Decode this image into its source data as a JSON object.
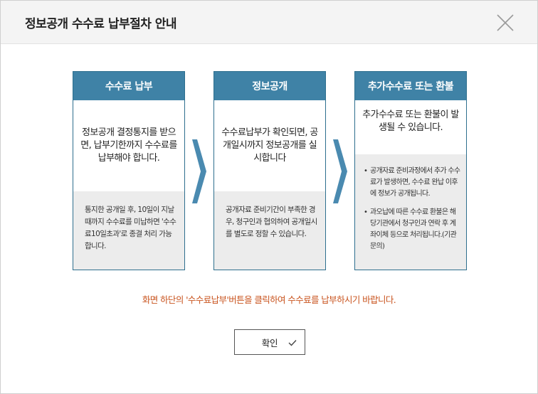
{
  "header": {
    "title": "정보공개 수수료 납부절차 안내",
    "close_icon": "close-icon"
  },
  "steps": [
    {
      "title": "수수료 납부",
      "main": "정보공개 결정통지를 받으면, 납부기한까지 수수료를 납부해야 합니다.",
      "sub": "통지한 공개일 후, 10일이 지날 때까지 수수료를 미납하면 '수수료10일초과'로 종결 처리 가능합니다."
    },
    {
      "title": "정보공개",
      "main": "수수료납부가 확인되면, 공개일시까지 정보공개를 실시합니다",
      "sub": "공개자료 준비기간이 부족한 경우, 청구인과 협의하여 공개일시를 별도로 정할 수 있습니다."
    },
    {
      "title": "추가수수료 또는 환불",
      "main": "추가수수료 또는 환불이 발생될 수 있습니다.",
      "bullets": [
        "공개자료 준비과정에서 추가 수수료가 발생하면, 수수료 완납 이후에 정보가 공개됩니다.",
        "과오납에 따른 수수료 환불은 해당기관에서 청구인과 연락 후 계좌이체 등으로 처리됩니다.(기관문의)"
      ]
    }
  ],
  "notice": "화면 하단의 '수수료납부'버튼을 클릭하여 수수료를 납부하시기 바랍니다.",
  "confirm": {
    "label": "확인",
    "icon": "check-icon"
  },
  "colors": {
    "card_header": "#3f82a6",
    "card_border": "#2e6f8e",
    "arrow": "#4a8ab0",
    "notice_text": "#c9541f",
    "sub_background": "#ececec"
  }
}
